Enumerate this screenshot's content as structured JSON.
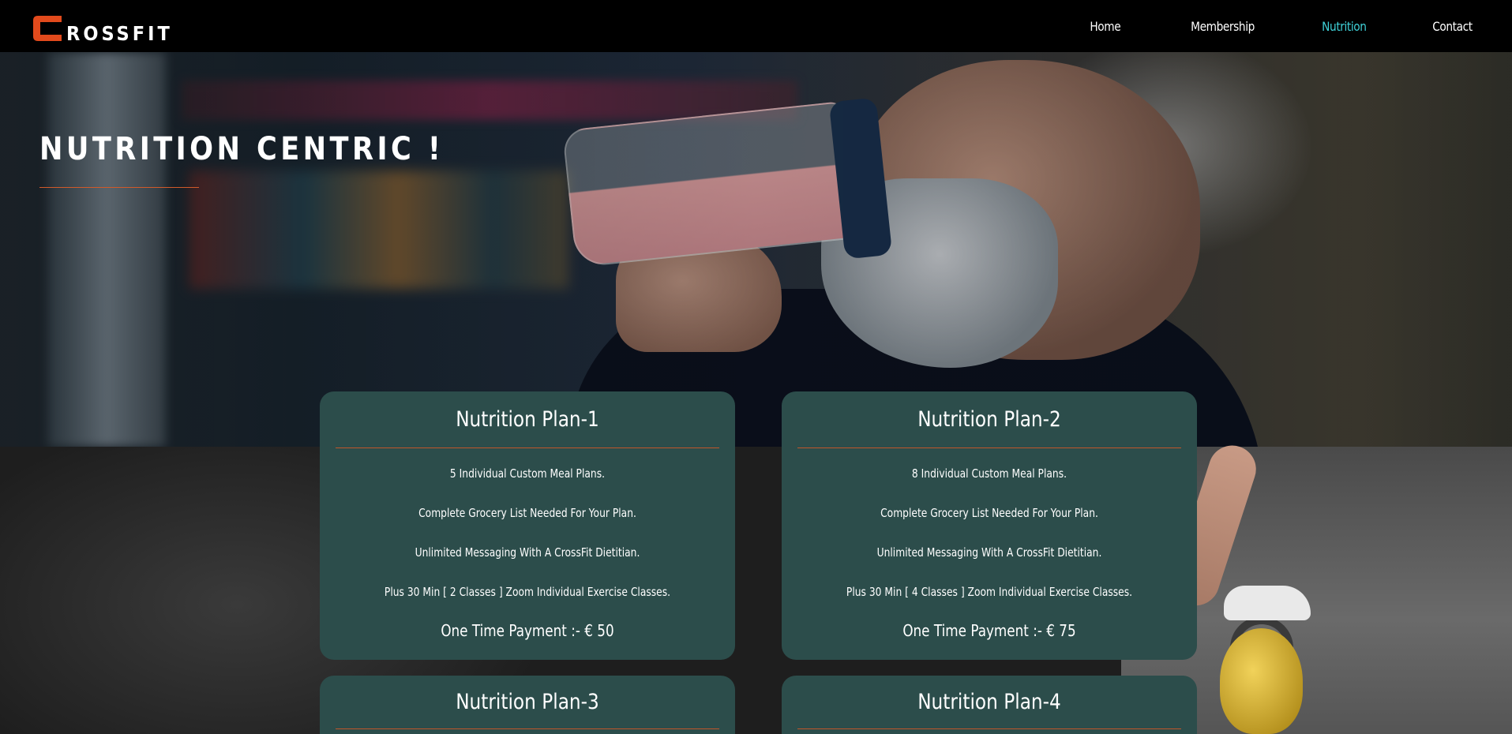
{
  "brand": {
    "initial": "C",
    "name": "ROSSFIT",
    "accent": "#e24a1c"
  },
  "nav": {
    "items": [
      {
        "label": "Home",
        "active": false
      },
      {
        "label": "Membership",
        "active": false
      },
      {
        "label": "Nutrition",
        "active": true
      },
      {
        "label": "Contact",
        "active": false
      }
    ],
    "active_color": "#3fd1d8"
  },
  "hero": {
    "title": "NUTRITION CENTRIC !"
  },
  "plans": [
    {
      "title": "Nutrition Plan-1",
      "features": [
        "5 Individual Custom Meal Plans.",
        "Complete Grocery List Needed For Your Plan.",
        "Unlimited Messaging With A CrossFit Dietitian.",
        "Plus 30 Min [ 2 Classes ] Zoom Individual Exercise Classes."
      ],
      "price": "One Time Payment :- € 50"
    },
    {
      "title": "Nutrition Plan-2",
      "features": [
        "8 Individual Custom Meal Plans.",
        "Complete Grocery List Needed For Your Plan.",
        "Unlimited Messaging With A CrossFit Dietitian.",
        "Plus 30 Min [ 4 Classes ] Zoom Individual Exercise Classes."
      ],
      "price": "One Time Payment :- € 75"
    },
    {
      "title": "Nutrition Plan-3"
    },
    {
      "title": "Nutrition Plan-4"
    }
  ],
  "colors": {
    "card_bg": "#2c4d4b",
    "divider": "#c0562a"
  }
}
